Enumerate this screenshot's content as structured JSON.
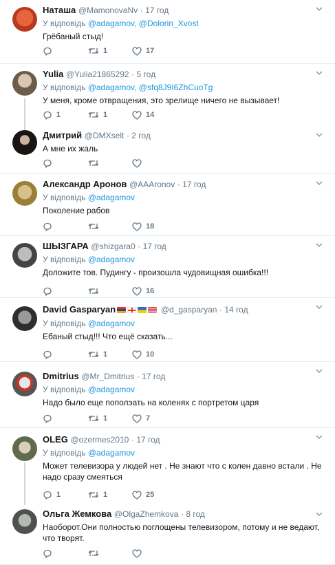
{
  "colors": {
    "accent": "#1b95e0",
    "muted": "#657786",
    "border": "#e6ecf0",
    "thread": "#ccd6dd"
  },
  "tweets": [
    {
      "name": "Наташа",
      "handle": "@MamonovaNv",
      "time": "· 17 год",
      "reply_prefix": "У відповідь",
      "mentions": "@adagamov, @Dolorin_Xvost",
      "text": "Грёбаный стыд!",
      "replies": "",
      "retweets": "1",
      "likes": "17"
    },
    {
      "name": "Yulia",
      "handle": "@Yulia21865292",
      "time": "· 5 год",
      "reply_prefix": "У відповідь",
      "mentions": "@adagamov, @sfq8J9I6ZhCuoTg",
      "text": "У меня, кроме отвращения, это зрелище ничего не вызывает!",
      "replies": "1",
      "retweets": "1",
      "likes": "14"
    },
    {
      "name": "Дмитрий",
      "handle": "@DMXselt",
      "time": "· 2 год",
      "reply_prefix": "",
      "mentions": "",
      "text": "А мне их жаль",
      "replies": "",
      "retweets": "",
      "likes": ""
    },
    {
      "name": "Александр Аронов",
      "handle": "@AAAronov",
      "time": "· 17 год",
      "reply_prefix": "У відповідь",
      "mentions": "@adagamov",
      "text": "Поколение рабов",
      "replies": "",
      "retweets": "",
      "likes": "18"
    },
    {
      "name": "ШЫЗГАРА",
      "handle": "@shizgara0",
      "time": "· 17 год",
      "reply_prefix": "У відповідь",
      "mentions": "@adagamov",
      "text": "Доложите тов. Пудингу - произошла чудовищная ошибка!!!",
      "replies": "",
      "retweets": "",
      "likes": "16"
    },
    {
      "name": "David Gasparyan",
      "handle": "@d_gasparyan",
      "time": "· 14 год",
      "reply_prefix": "У відповідь",
      "mentions": "@adagamov",
      "text": "Ебаный стыд!!! Что ещё сказать...",
      "replies": "",
      "retweets": "1",
      "likes": "10"
    },
    {
      "name": "Dmitrius",
      "handle": "@Mr_Dmitrius",
      "time": "· 17 год",
      "reply_prefix": "У відповідь",
      "mentions": "@adagamov",
      "text": "Надо было еще пополэать на коленях с портретом царя",
      "replies": "",
      "retweets": "1",
      "likes": "7"
    },
    {
      "name": "OLEG",
      "handle": "@ozermes2010",
      "time": "· 17 год",
      "reply_prefix": "У відповідь",
      "mentions": "@adagamov",
      "text": "Может телевизора у людей нет . Не знают что с колен давно встали . Не надо сразу смеяться",
      "replies": "1",
      "retweets": "1",
      "likes": "25"
    },
    {
      "name": "Ольга Жемкова",
      "handle": "@OlgaZhemkova",
      "time": "· 8 год",
      "reply_prefix": "",
      "mentions": "",
      "text": "Наоборот.Они полностью поглощены телевизором, потому и не ведают, что творят.",
      "replies": "",
      "retweets": "",
      "likes": ""
    }
  ]
}
